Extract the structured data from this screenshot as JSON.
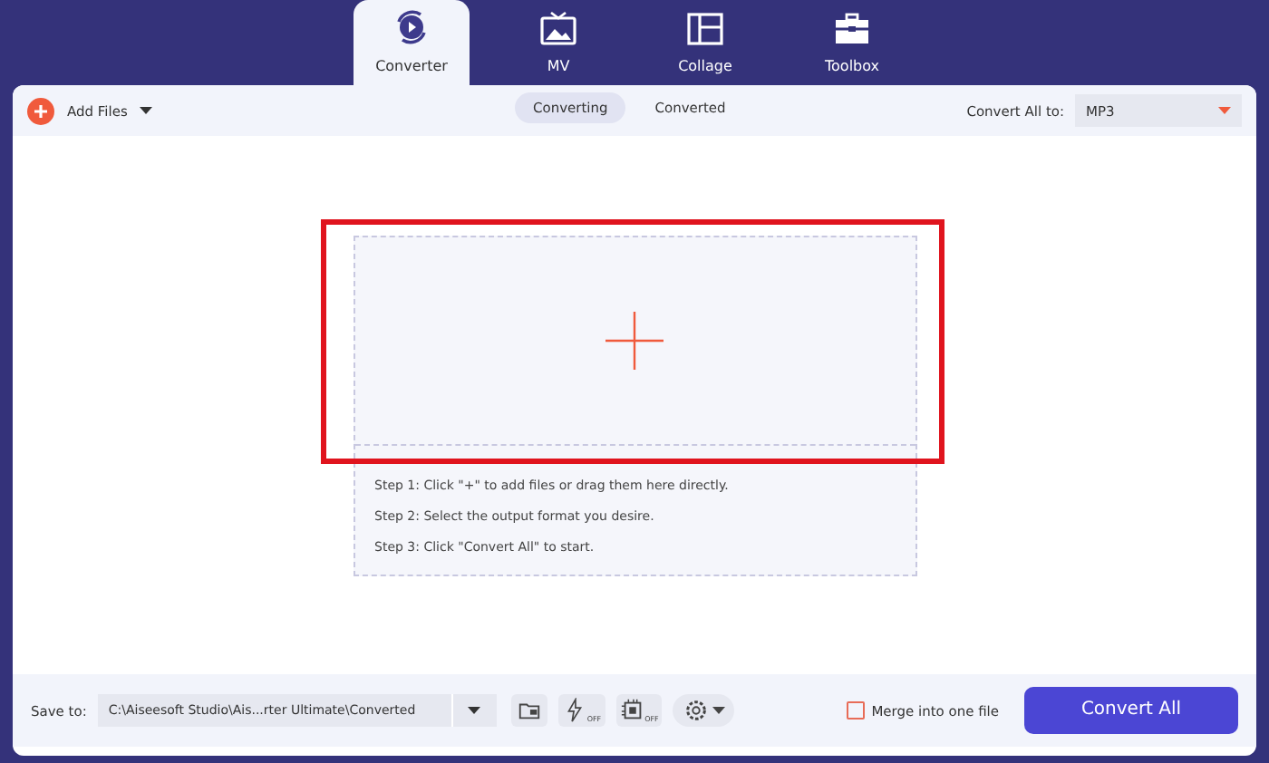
{
  "tabs": [
    {
      "label": "Converter",
      "kind": "converter",
      "selected": true
    },
    {
      "label": "MV",
      "kind": "mv",
      "selected": false
    },
    {
      "label": "Collage",
      "kind": "collage",
      "selected": false
    },
    {
      "label": "Toolbox",
      "kind": "toolbox",
      "selected": false
    }
  ],
  "toolbar": {
    "add_files": "Add Files",
    "status_tabs": [
      {
        "label": "Converting",
        "selected": true
      },
      {
        "label": "Converted",
        "selected": false
      }
    ],
    "convert_all_to": {
      "label": "Convert All to:",
      "value": "MP3"
    }
  },
  "drop_zone": {
    "steps": [
      "Step 1: Click \"+\" to add files or drag them here directly.",
      "Step 2: Select the output format you desire.",
      "Step 3: Click \"Convert All\" to start."
    ]
  },
  "bottom_bar": {
    "save_to": {
      "label": "Save to:",
      "value": "C:\\Aiseesoft Studio\\Ais...rter Ultimate\\Converted"
    },
    "tools": [
      {
        "kind": "folder"
      },
      {
        "kind": "flash",
        "badge": "OFF"
      },
      {
        "kind": "chip",
        "badge": "OFF"
      },
      {
        "kind": "settings"
      }
    ],
    "merge": {
      "label": "Merge into one file",
      "checked": false
    },
    "convert_button": "Convert All"
  }
}
